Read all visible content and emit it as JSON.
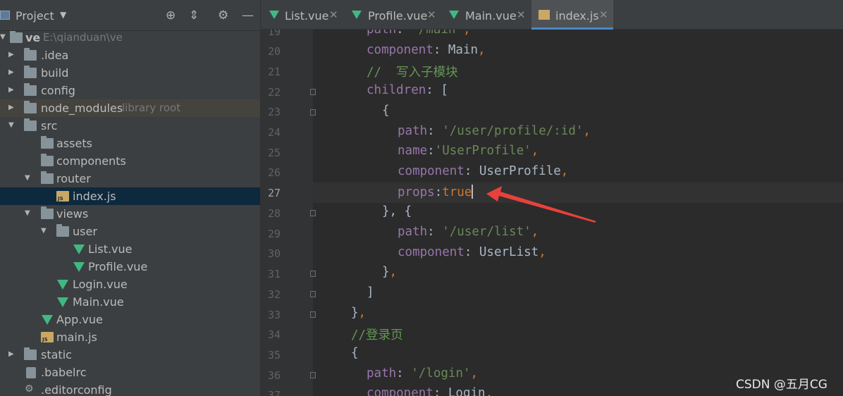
{
  "project_panel": {
    "title": "Project",
    "tree": [
      {
        "name": "ve",
        "extra": "E:\\qianduan\\ve",
        "icon": "project-folder-icon"
      },
      {
        "name": ".idea",
        "icon": "folder-icon"
      },
      {
        "name": "build",
        "icon": "folder-icon"
      },
      {
        "name": "config",
        "icon": "folder-icon"
      },
      {
        "name": "node_modules",
        "extra": "library root",
        "icon": "folder-icon"
      },
      {
        "name": "src",
        "icon": "folder-icon"
      },
      {
        "name": "assets",
        "icon": "folder-icon"
      },
      {
        "name": "components",
        "icon": "folder-icon"
      },
      {
        "name": "router",
        "icon": "folder-icon"
      },
      {
        "name": "index.js",
        "icon": "js-file-icon"
      },
      {
        "name": "views",
        "icon": "folder-icon"
      },
      {
        "name": "user",
        "icon": "folder-icon"
      },
      {
        "name": "List.vue",
        "icon": "vue-file-icon"
      },
      {
        "name": "Profile.vue",
        "icon": "vue-file-icon"
      },
      {
        "name": "Login.vue",
        "icon": "vue-file-icon"
      },
      {
        "name": "Main.vue",
        "icon": "vue-file-icon"
      },
      {
        "name": "App.vue",
        "icon": "vue-file-icon"
      },
      {
        "name": "main.js",
        "icon": "js-file-icon"
      },
      {
        "name": "static",
        "icon": "folder-icon"
      },
      {
        "name": ".babelrc",
        "icon": "config-file-icon"
      },
      {
        "name": ".editorconfig",
        "icon": "gear-icon"
      }
    ]
  },
  "tabs": [
    {
      "label": "List.vue",
      "icon": "vue-file-icon"
    },
    {
      "label": "Profile.vue",
      "icon": "vue-file-icon"
    },
    {
      "label": "Main.vue",
      "icon": "vue-file-icon"
    },
    {
      "label": "index.js",
      "icon": "js-file-icon",
      "active": true
    }
  ],
  "editor": {
    "current_line": "27",
    "lines": [
      {
        "n": "19",
        "text": "path: '/main',"
      },
      {
        "n": "20",
        "text": "component: Main,"
      },
      {
        "n": "21",
        "text": "//  写入子模块"
      },
      {
        "n": "22",
        "text": "children: ["
      },
      {
        "n": "23",
        "text": "{"
      },
      {
        "n": "24",
        "text": "path: '/user/profile/:id',"
      },
      {
        "n": "25",
        "text": "name:'UserProfile',"
      },
      {
        "n": "26",
        "text": "component: UserProfile,"
      },
      {
        "n": "27",
        "text": "props:true"
      },
      {
        "n": "28",
        "text": "}, {"
      },
      {
        "n": "29",
        "text": "path: '/user/list',"
      },
      {
        "n": "30",
        "text": "component: UserList,"
      },
      {
        "n": "31",
        "text": "},"
      },
      {
        "n": "32",
        "text": "]"
      },
      {
        "n": "33",
        "text": "},"
      },
      {
        "n": "34",
        "text": "//登录页"
      },
      {
        "n": "35",
        "text": "{"
      },
      {
        "n": "36",
        "text": "path: '/login',"
      },
      {
        "n": "37",
        "text": "component: Login,"
      }
    ]
  },
  "annotation": {
    "color": "#e8413c"
  },
  "watermark": "CSDN @五月CG",
  "colors": {
    "keyword": "#9876aa",
    "string": "#6a8759",
    "comment": "#629755",
    "operator": "#cc7832",
    "accent": "#4a88c7"
  }
}
